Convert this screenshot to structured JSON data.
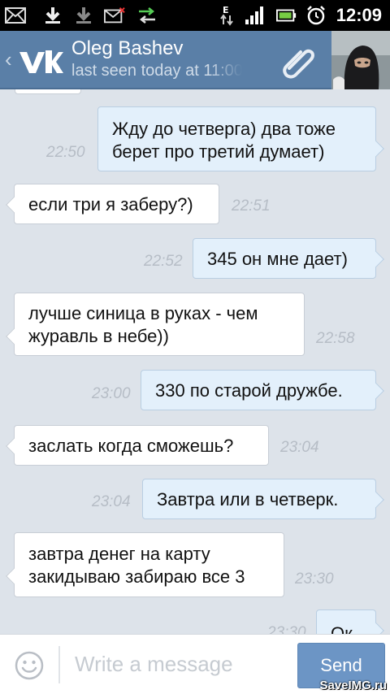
{
  "status_bar": {
    "time": "12:09",
    "icons": [
      "mail-icon",
      "download-icon",
      "download-icon",
      "mail-error-icon",
      "sync-icon",
      "data-arrows-icon",
      "signal-icon",
      "battery-icon",
      "alarm-icon"
    ]
  },
  "header": {
    "name": "Oleg Bashev",
    "last_seen": "last seen today at 11:00",
    "icons": [
      "back-chevron-icon",
      "vk-logo",
      "paperclip-icon"
    ]
  },
  "messages": [
    {
      "dir": "out",
      "lines": [
        "Жду до четверга) два тоже",
        "берет про третий думает)"
      ],
      "time": "22:50"
    },
    {
      "dir": "in",
      "lines": [
        "если три я заберу?)"
      ],
      "time": "22:51"
    },
    {
      "dir": "out",
      "lines": [
        "345 он мне дает)"
      ],
      "time": "22:52"
    },
    {
      "dir": "in",
      "lines": [
        "лучше синица в руках - чем",
        "журавль в небе))"
      ],
      "time": "22:58"
    },
    {
      "dir": "out",
      "lines": [
        "330 по старой дружбе."
      ],
      "time": "23:00"
    },
    {
      "dir": "in",
      "lines": [
        "заслать когда сможешь?"
      ],
      "time": "23:04"
    },
    {
      "dir": "out",
      "lines": [
        "Завтра или в четверк."
      ],
      "time": "23:04"
    },
    {
      "dir": "in",
      "lines": [
        "завтра денег на карту",
        "закидываю забираю все 3"
      ],
      "time": "23:30"
    },
    {
      "dir": "out",
      "lines": [
        "Ок"
      ],
      "time": "23:30"
    }
  ],
  "input": {
    "placeholder": "Write a message",
    "send_label": "Send"
  },
  "watermark": "SaveIMG.ru",
  "colors": {
    "header_bg": "#5a7fa7",
    "chat_bg": "#dde3ea",
    "out_bubble": "#e3f0fb",
    "in_bubble": "#ffffff",
    "send_button": "#6c95c5"
  }
}
